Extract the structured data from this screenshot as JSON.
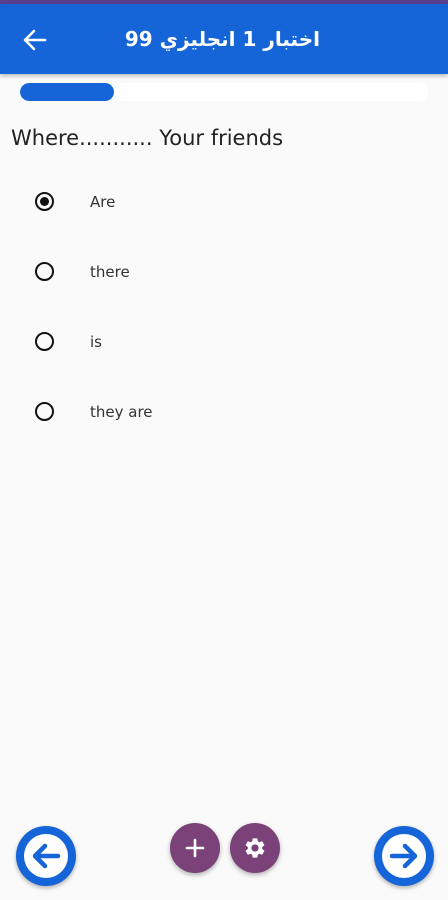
{
  "header": {
    "title": "اختبار 1 انجليزي 99",
    "back_icon": "arrow-left-icon"
  },
  "progress": {
    "fraction": 0.23
  },
  "question": {
    "text": "Where........... Your friends"
  },
  "options": [
    {
      "label": "Are",
      "selected": true
    },
    {
      "label": "there",
      "selected": false
    },
    {
      "label": "is",
      "selected": false
    },
    {
      "label": "they are",
      "selected": false
    }
  ],
  "footer": {
    "prev_icon": "arrow-left-circle-icon",
    "add_icon": "plus-icon",
    "settings_icon": "gear-icon",
    "next_icon": "arrow-right-circle-icon"
  },
  "colors": {
    "primary": "#1565d8",
    "fab": "#7a4278",
    "status_strip": "#5a3f8f"
  }
}
